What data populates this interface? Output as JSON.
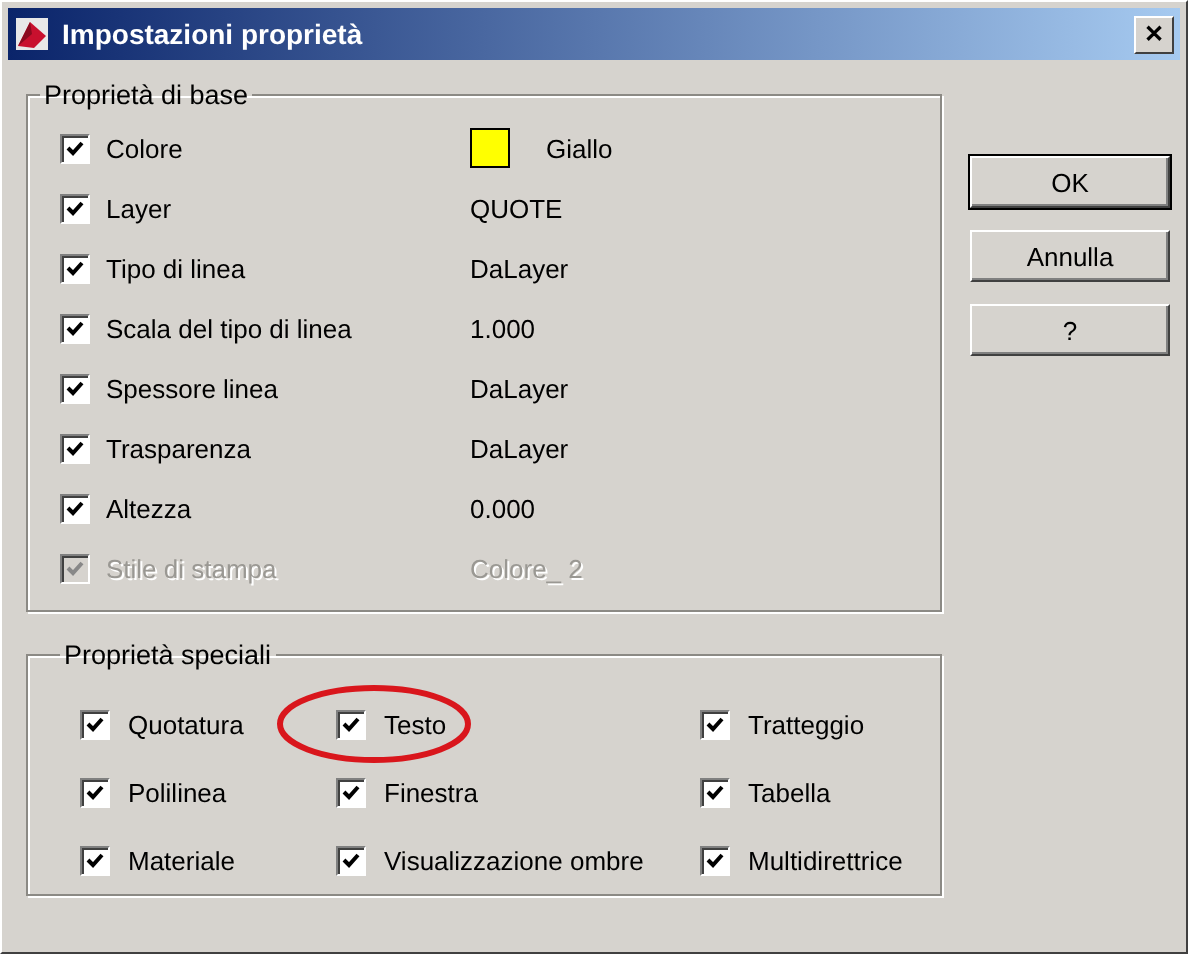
{
  "window": {
    "title": "Impostazioni proprietà",
    "close": "✕"
  },
  "basic": {
    "title": "Proprietà di base",
    "rows": [
      {
        "label": "Colore",
        "checked": true,
        "disabled": false,
        "value": "Giallo",
        "color": "#ffff00"
      },
      {
        "label": "Layer",
        "checked": true,
        "disabled": false,
        "value": "QUOTE"
      },
      {
        "label": "Tipo di linea",
        "checked": true,
        "disabled": false,
        "value": "DaLayer"
      },
      {
        "label": "Scala del tipo di linea",
        "checked": true,
        "disabled": false,
        "value": "1.000"
      },
      {
        "label": "Spessore linea",
        "checked": true,
        "disabled": false,
        "value": "DaLayer"
      },
      {
        "label": "Trasparenza",
        "checked": true,
        "disabled": false,
        "value": "DaLayer"
      },
      {
        "label": "Altezza",
        "checked": true,
        "disabled": false,
        "value": "0.000"
      },
      {
        "label": "Stile di stampa",
        "checked": true,
        "disabled": true,
        "value": "Colore_ 2"
      }
    ]
  },
  "special": {
    "title": "Proprietà speciali",
    "items": [
      {
        "label": "Quotatura",
        "checked": true,
        "highlighted": false
      },
      {
        "label": "Testo",
        "checked": true,
        "highlighted": true
      },
      {
        "label": "Tratteggio",
        "checked": true,
        "highlighted": false
      },
      {
        "label": "Polilinea",
        "checked": true,
        "highlighted": false
      },
      {
        "label": "Finestra",
        "checked": true,
        "highlighted": false
      },
      {
        "label": "Tabella",
        "checked": true,
        "highlighted": false
      },
      {
        "label": "Materiale",
        "checked": true,
        "highlighted": false
      },
      {
        "label": "Visualizzazione ombre",
        "checked": true,
        "highlighted": false
      },
      {
        "label": "Multidirettrice",
        "checked": true,
        "highlighted": false
      }
    ]
  },
  "buttons": [
    "OK",
    "Annulla",
    "?"
  ]
}
